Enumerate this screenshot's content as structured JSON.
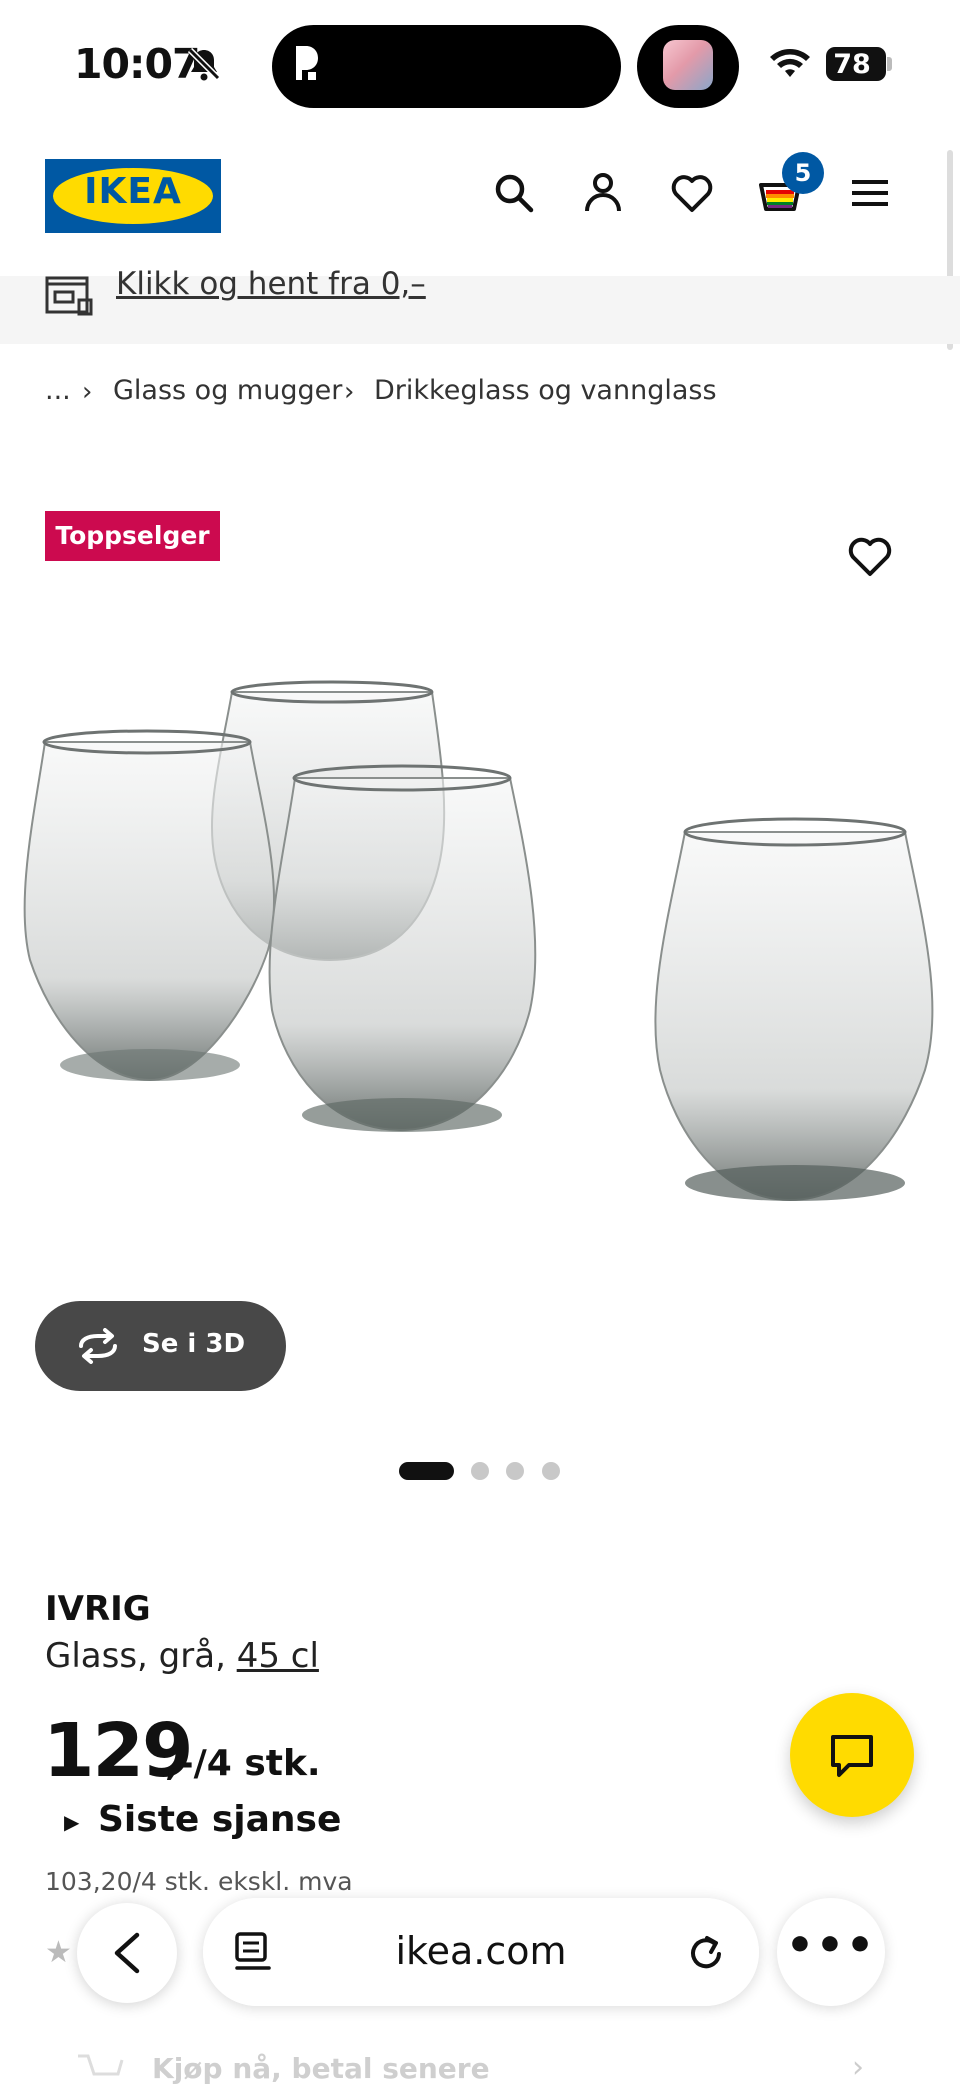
{
  "status_bar": {
    "time": "10:07",
    "battery": "78",
    "icons": [
      "bell-muted-icon",
      "wifi-icon",
      "battery-icon"
    ]
  },
  "header": {
    "logo_text": "IKEA",
    "cart_count": "5",
    "icons": [
      "search-icon",
      "account-icon",
      "heart-icon",
      "cart-icon",
      "menu-icon"
    ]
  },
  "banner": {
    "text": "Klikk og hent fra 0,–"
  },
  "breadcrumb": {
    "items": [
      "...",
      "Glass og mugger",
      "Drikkeglass og vannglass"
    ],
    "separator": "›"
  },
  "product": {
    "badge": "Toppselger",
    "view_3d_label": "Se i 3D",
    "carousel": {
      "total": 4,
      "active": 1
    },
    "name": "IVRIG",
    "description": "Glass, grå, ",
    "size_link": "45 cl",
    "price_main": "129",
    "price_suffix": ",-/4 stk.",
    "last_chance": "Siste sjanse",
    "price_ex_vat": "103,20/4 stk. ekskl. mva",
    "bnpl": "Kjøp nå, betal senere"
  },
  "browser": {
    "url": "ikea.com",
    "more": "•••"
  },
  "colors": {
    "ikea_blue": "#0058a3",
    "ikea_yellow": "#ffdb00",
    "badge_red": "#cc0a4f"
  }
}
